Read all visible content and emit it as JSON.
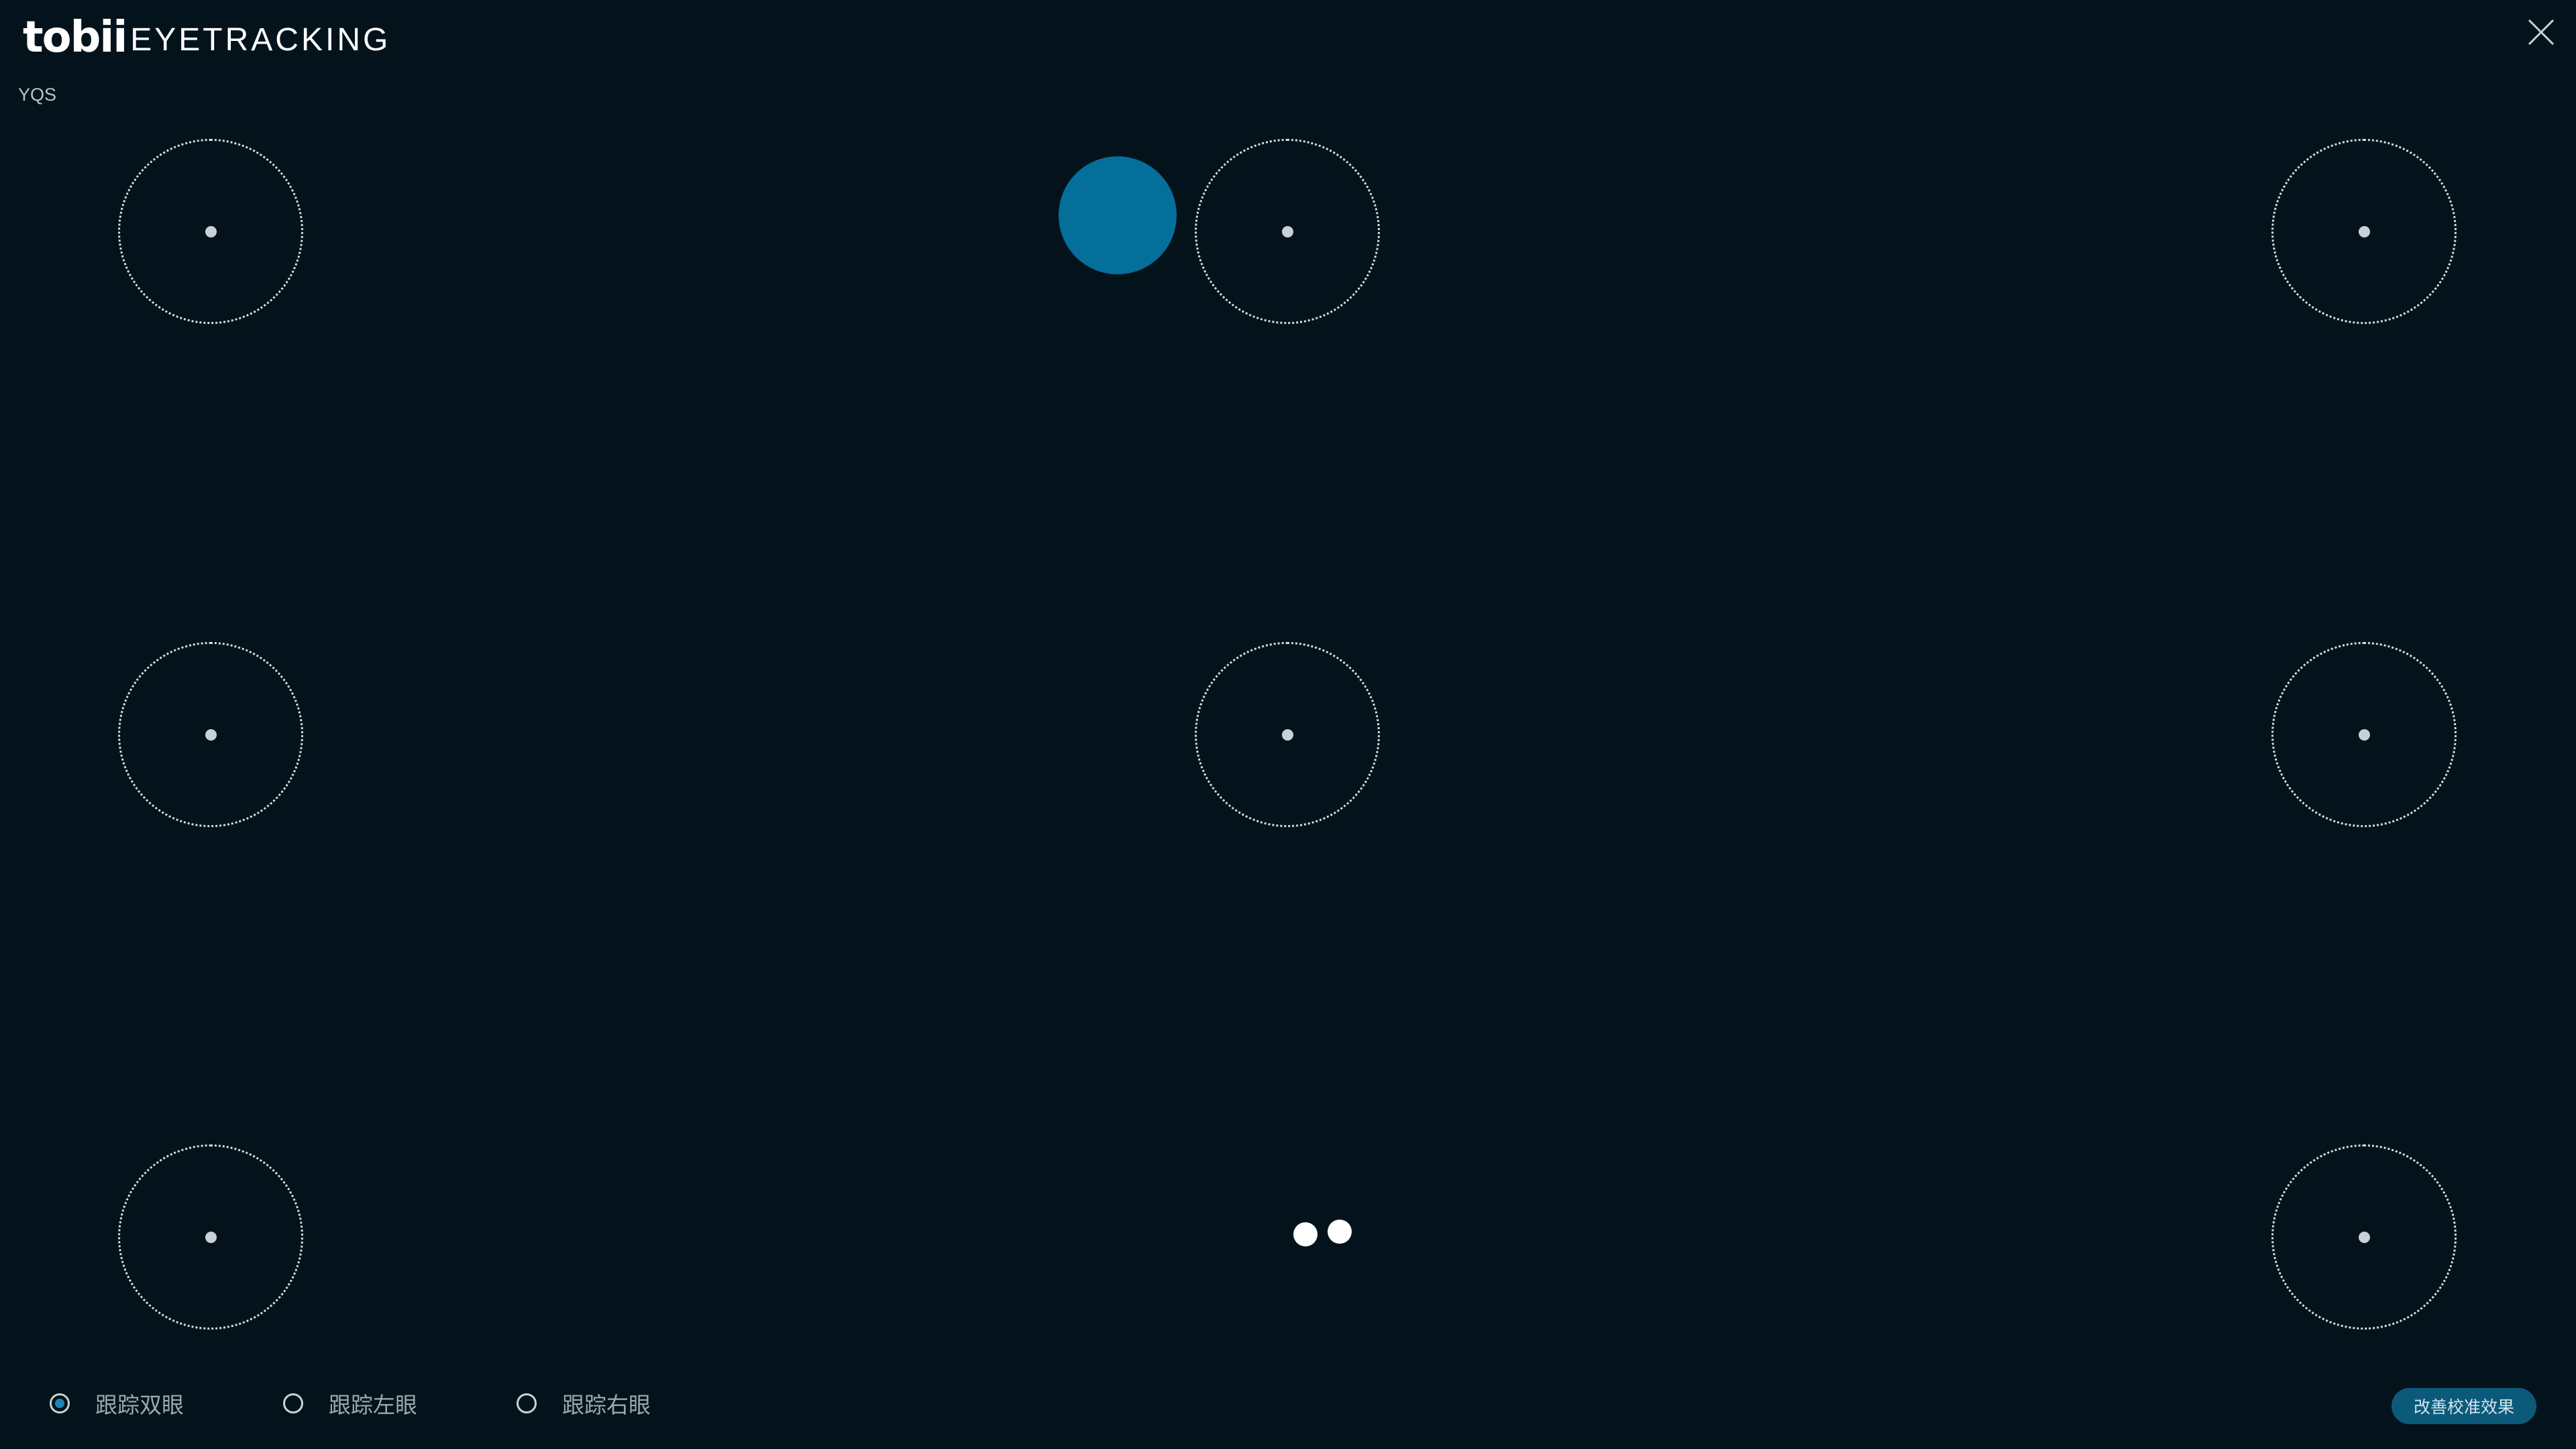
{
  "header": {
    "logo_mark": "tobii",
    "logo_text": "EYETRACKING",
    "profile_name": "YQS",
    "close_icon": "close-icon"
  },
  "calibration": {
    "targets": [
      {
        "name": "calibration-target-top-left"
      },
      {
        "name": "calibration-target-top-center"
      },
      {
        "name": "calibration-target-top-right"
      },
      {
        "name": "calibration-target-middle-left"
      },
      {
        "name": "calibration-target-middle-center"
      },
      {
        "name": "calibration-target-middle-right"
      },
      {
        "name": "calibration-target-bottom-left"
      },
      {
        "name": "calibration-target-bottom-right"
      }
    ],
    "ball_color": "#046f9b",
    "eye_indicator_color": "#ffffff"
  },
  "tracking_options": [
    {
      "label": "跟踪双眼",
      "checked": true
    },
    {
      "label": "跟踪左眼",
      "checked": false
    },
    {
      "label": "跟踪右眼",
      "checked": false
    }
  ],
  "actions": {
    "improve_label": "改善校准效果"
  },
  "colors": {
    "background": "#04131b",
    "accent": "#1b86b4",
    "button": "#0b5a7a"
  }
}
